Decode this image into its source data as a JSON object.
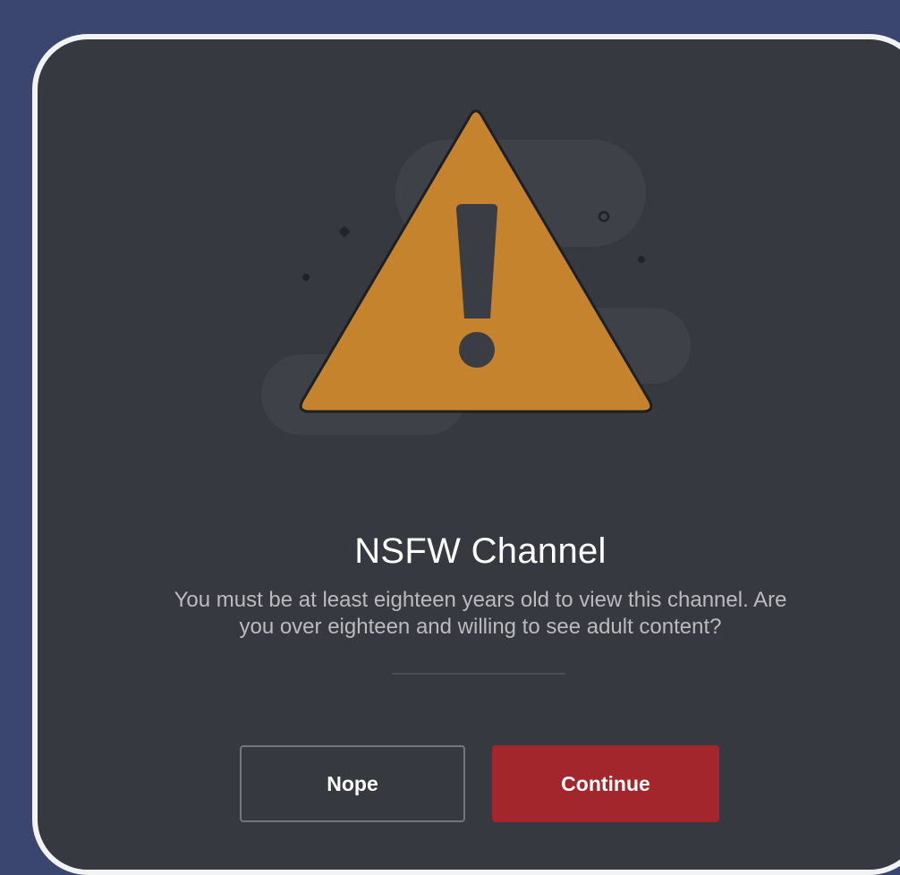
{
  "dialog": {
    "title": "NSFW Channel",
    "description_line1": "You must be at least eighteen years old to view this channel. Are",
    "description_line2": "you over eighteen and willing to see adult content?",
    "illustration_icon": "warning-triangle-icon",
    "buttons": {
      "nope_label": "Nope",
      "continue_label": "Continue"
    }
  },
  "colors": {
    "page_background": "#3a4570",
    "modal_background": "#36393f",
    "modal_border": "#f2f3f5",
    "warning_fill": "#c6832e",
    "continue_button": "#a3262d",
    "nope_border": "#72767d",
    "title_text": "#ffffff",
    "description_text": "#b9bbbe"
  }
}
